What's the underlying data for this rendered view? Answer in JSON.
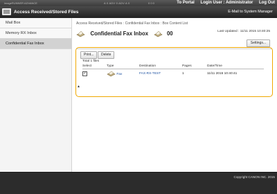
{
  "top_strip": {
    "left_text": "imageRUNNER ADVANCE",
    "mid_text": "A 0 ADV  0 ADV  A 0",
    "right_text": "0 0  0",
    "links": {
      "to_portal": "To Portal",
      "login_user": "Login User : Administrator",
      "log_out": "Log Out"
    }
  },
  "header": {
    "title": "Access Received/Stored Files",
    "system_manager": "E-Mail to System Manager"
  },
  "sidebar": {
    "items": [
      {
        "label": "Mail Box",
        "active": false
      },
      {
        "label": "Memory RX Inbox",
        "active": false
      },
      {
        "label": "Confidential Fax Inbox",
        "active": true
      }
    ]
  },
  "main": {
    "breadcrumb": "Access Received/Stored Files : Confidential Fax Inbox : Box Content List",
    "title": "Confidential Fax Inbox",
    "box_number": "00",
    "last_updated": "Last Updated : 11/11 2015 10:40:25",
    "settings_button": "Settings...",
    "print_button": "Print...",
    "delete_button": "Delete",
    "total_files": "Total 1 files",
    "table": {
      "columns": [
        "Select",
        "Type",
        "Destination",
        "Pages",
        "Date/Time"
      ],
      "rows": [
        {
          "selected": true,
          "checkmark": "✓",
          "type": "Fax",
          "destination": "FAX-RX-TEST",
          "pages": "1",
          "datetime": "11/11 2015 10:40:41"
        }
      ]
    }
  },
  "footer": {
    "copyright": "Copyright CANON INC. 2015"
  },
  "icons": {
    "app": "inbox-icon",
    "box": "fax-document-icon",
    "row_type": "fax-document-icon",
    "scroll_top": "up-arrow-icon"
  },
  "colors": {
    "highlight": "#f0a800",
    "link": "#1a4fa0",
    "header_bg": "#2a2a2a",
    "active_item": "#d2d2d2"
  }
}
